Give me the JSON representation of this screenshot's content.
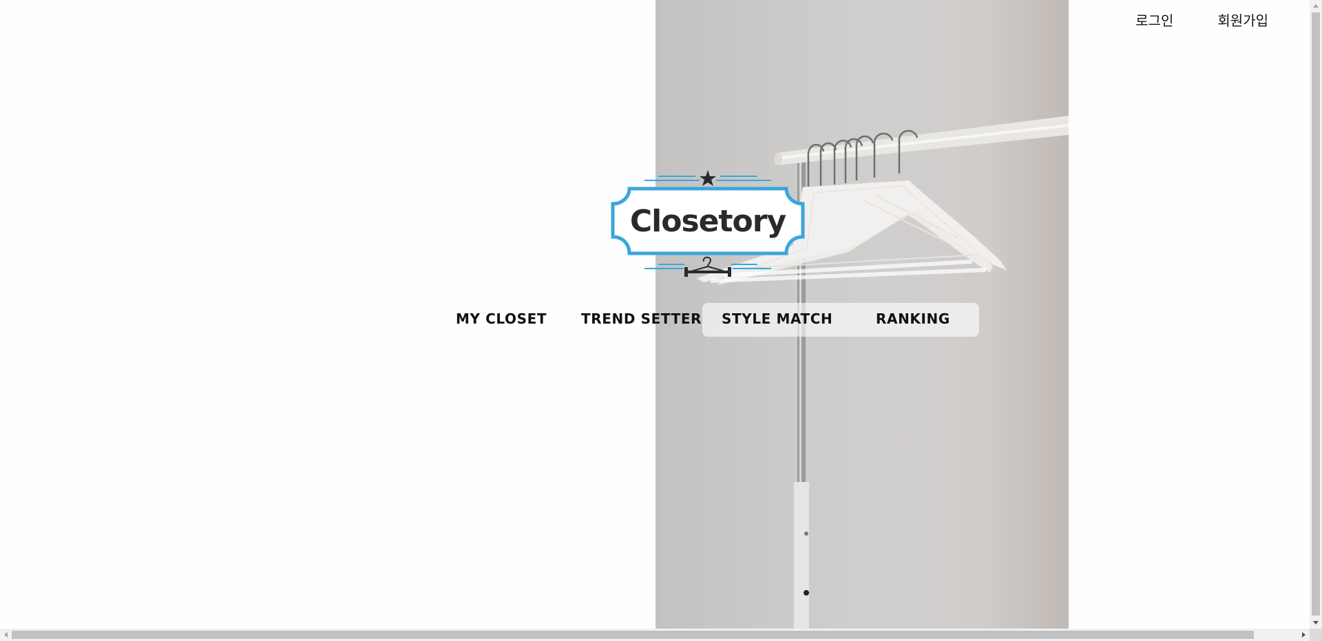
{
  "header": {
    "login_label": "로그인",
    "signup_label": "회원가입"
  },
  "logo": {
    "wordmark": "Closetory",
    "accent_color": "#3aa6dc",
    "icons": [
      "star-icon",
      "hanger-icon"
    ]
  },
  "nav": {
    "items": [
      {
        "label": "MY CLOSET"
      },
      {
        "label": "TREND SETTER"
      },
      {
        "label": "STYLE MATCH"
      },
      {
        "label": "RANKING"
      }
    ]
  },
  "hero": {
    "image_subject": "white hangers on clothing rack"
  }
}
